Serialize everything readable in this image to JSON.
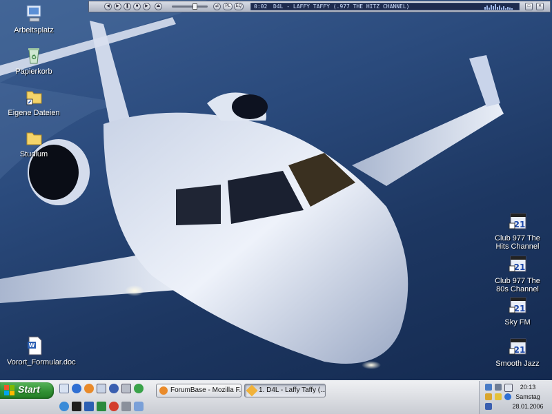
{
  "desktop_icons": {
    "arbeitsplatz": "Arbeitsplatz",
    "papierkorb": "Papierkorb",
    "eigene_dateien": "Eigene Dateien",
    "studium": "Studium",
    "vorort": "Vorort_Formular.doc",
    "club_hits": "Club 977 The Hits Channel",
    "club_80s": "Club 977 The 80s Channel",
    "sky_fm": "Sky FM",
    "smooth_jazz": "Smooth Jazz"
  },
  "winamp": {
    "time": "0:02",
    "title": "D4L - LAFFY TAFFY (.977 THE HITZ CHANNEL)",
    "pl_label": "PL",
    "eq_label": "EQ"
  },
  "taskbar": {
    "start_label": "Start",
    "tasks": [
      {
        "label": "ForumBase - Mozilla F..."
      },
      {
        "label": "1. D4L - Laffy Taffy (..."
      }
    ],
    "clock": {
      "time": "20:13",
      "day": "Samstag",
      "date": "28.01.2006"
    }
  },
  "colors": {
    "taskbar": "#d9dce2",
    "start_green": "#3a9a3c",
    "desktop_sky": "#2a4a7c"
  }
}
